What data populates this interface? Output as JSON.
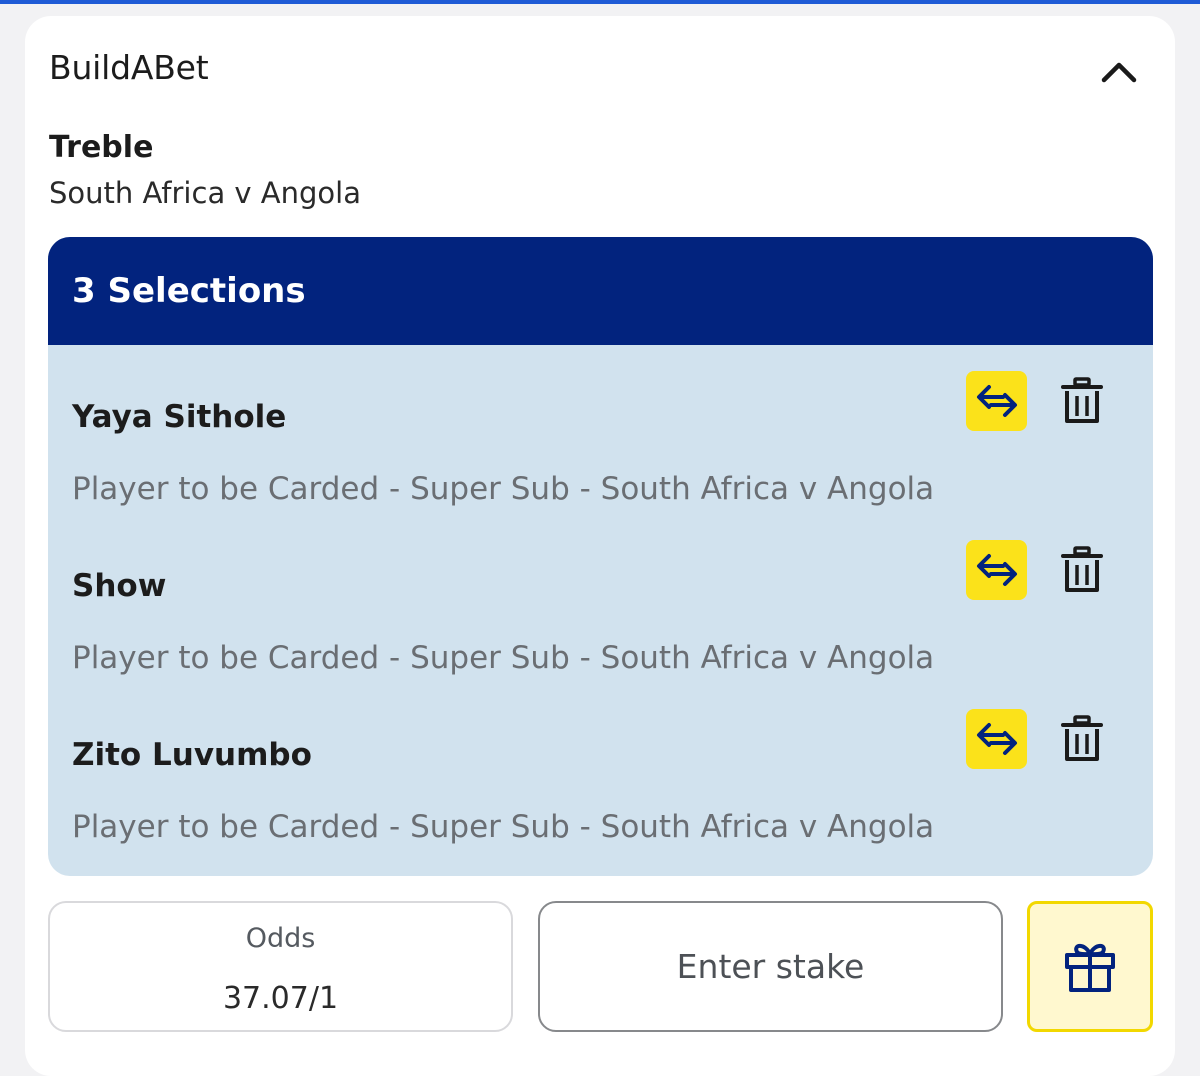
{
  "card": {
    "title": "BuildABet",
    "collapse_icon": "chevron-up-icon"
  },
  "bet": {
    "type": "Treble",
    "event": "South Africa v Angola"
  },
  "selections": {
    "header": "3 Selections",
    "items": [
      {
        "name": "Yaya Sithole",
        "description": "Player to be Carded - Super Sub - South Africa v Angola"
      },
      {
        "name": "Show",
        "description": "Player to be Carded - Super Sub - South Africa v Angola"
      },
      {
        "name": "Zito Luvumbo",
        "description": "Player to be Carded - Super Sub - South Africa v Angola"
      }
    ],
    "swap_icon": "swap-arrows-icon",
    "delete_icon": "trash-icon"
  },
  "footer": {
    "odds_label": "Odds",
    "odds_value": "37.07/1",
    "stake_placeholder": "Enter stake",
    "gift_icon": "gift-icon"
  },
  "colors": {
    "header_navy": "#02237e",
    "panel_blue": "#d1e2ee",
    "accent_yellow": "#fbe21a",
    "top_rule": "#1f5bd6"
  }
}
